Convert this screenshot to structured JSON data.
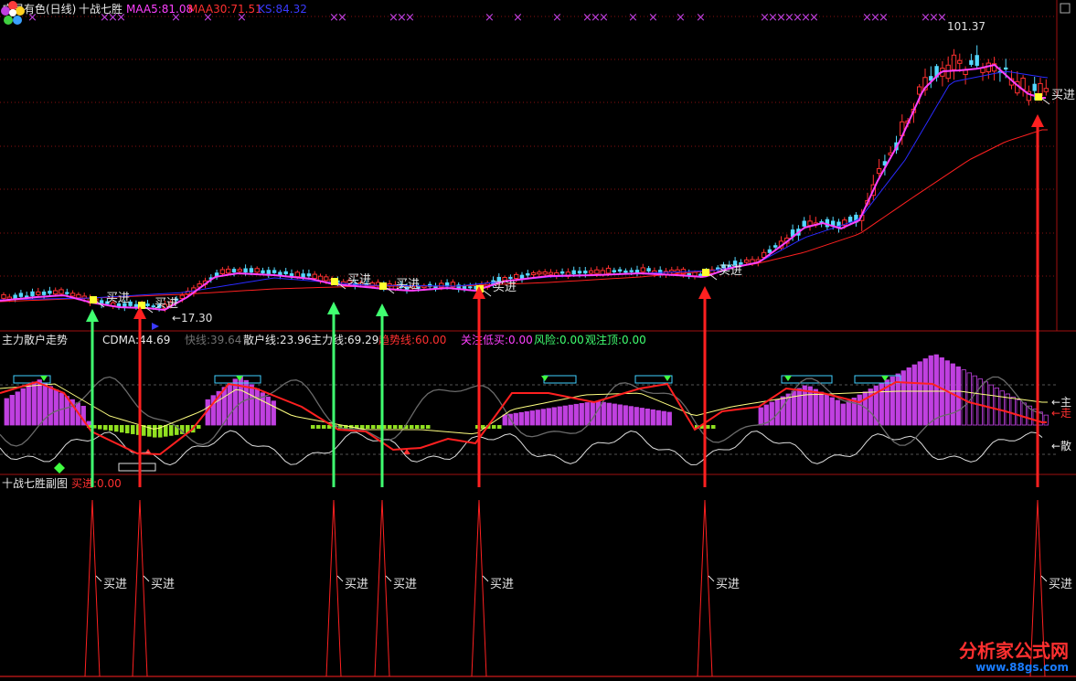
{
  "main": {
    "stock": "广晟有色(日线)",
    "indicator": "十战七胜",
    "maa5": "MAA5:81.08",
    "maa30": "MAA30:71.51",
    "ks": "KS:84.32",
    "high_label": "101.37",
    "low_label": "←17.30",
    "buy_label": "买进"
  },
  "panel2": {
    "title": "主力散户走势",
    "cdma": "CDMA:44.69",
    "fast": "快线:39.64",
    "retail": "散户线:23.96",
    "main_line": "主力线:69.29",
    "trend": "趋势线:60.00",
    "watch": "关注低买:0.00",
    "risk": "风险:0.00",
    "top": "观注顶:0.00",
    "right_labels": [
      "←主",
      "←走",
      "←散"
    ]
  },
  "panel3": {
    "title": "十战七胜副图",
    "buy": "买进:0.00",
    "buy_label": "买进"
  },
  "watermark": {
    "name": "分析家公式网",
    "url": "www.88gs.com"
  },
  "colors": {
    "up": "#ff3030",
    "down": "#54d8ff",
    "ma5": "#ff40ff",
    "ma30": "#ff2020",
    "ks": "#2a2aff",
    "buy_green": "#40ff70",
    "buy_red": "#ff2020",
    "bar_purple": "#c040e0",
    "bar_green": "#90e020"
  },
  "chart_data": {
    "type": "candlestick",
    "price_high": 101.37,
    "price_low": 17.3,
    "buy_signal_count": 8
  }
}
